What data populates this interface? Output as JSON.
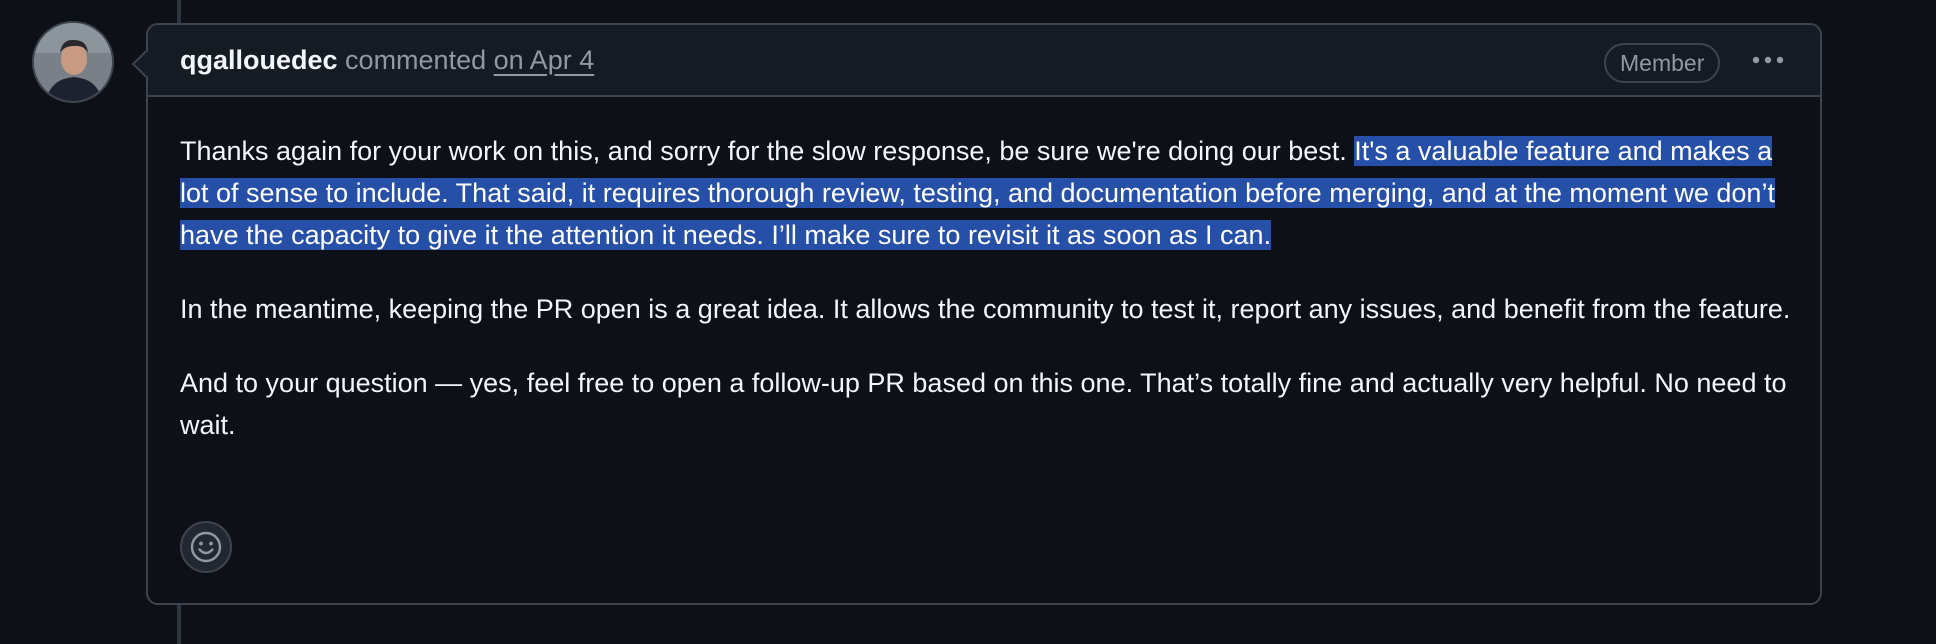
{
  "comment": {
    "author": "qgallouedec",
    "action": "commented",
    "date": "on Apr 4",
    "badge": "Member",
    "more_icon": "kebab-horizontal-icon",
    "paragraph1_plain": "Thanks again for your work on this, and sorry for the slow response, be sure we're doing our best. ",
    "paragraph1_selected": "It's a valuable feature and makes a lot of sense to include. That said, it requires thorough review, testing, and documentation before merging, and at the moment we don’t have the capacity to give it the attention it needs. I’ll make sure to revisit it as soon as I can.",
    "paragraph2": "In the meantime, keeping the PR open is a great idea. It allows the community to test it, report any issues, and benefit from the feature.",
    "paragraph3": "And to your question — yes, feel free to open a follow-up PR based on this one. That’s totally fine and actually very helpful. No need to wait.",
    "reaction_icon": "smiley-icon"
  },
  "colors": {
    "background": "#0d1117",
    "header_bg": "#151b23",
    "border": "#3d444d",
    "muted_text": "#9198a1",
    "text": "#f0f6fc",
    "selection": "#264fa8"
  }
}
